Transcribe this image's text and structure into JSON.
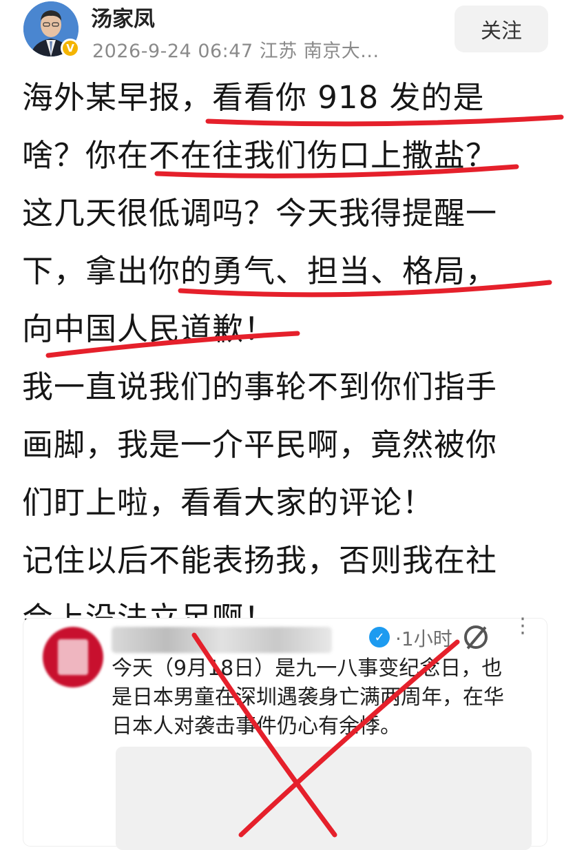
{
  "post": {
    "author": {
      "name": "汤家凤",
      "verified_badge": "V"
    },
    "meta": "2026-9-24 06:47  江苏  南京大...",
    "follow_label": "关注",
    "lines": [
      "海外某早报，看看你 918 发的是",
      "啥？你在不在往我们伤口上撒盐？",
      "这几天很低调吗？今天我得提醒一",
      "下，拿出你的勇气、担当、格局，",
      "向中国人民道歉！",
      "我一直说我们的事轮不到你们指手",
      "画脚，我是一介平民啊，竟然被你",
      "们盯上啦，看看大家的评论！",
      "记住以后不能表扬我，否则我在社",
      "会上没法立足啊！"
    ],
    "underline_color": "#e5202b"
  },
  "quoted": {
    "time": "·1小时",
    "text_lines": [
      "今天（9月18日）是九一八事变纪念日，也",
      "是日本男童在深圳遇袭身亡满两周年，在华",
      "日本人对袭击事件仍心有余悸。"
    ],
    "more_icon": "⋮",
    "cross_color": "#e5202b"
  }
}
